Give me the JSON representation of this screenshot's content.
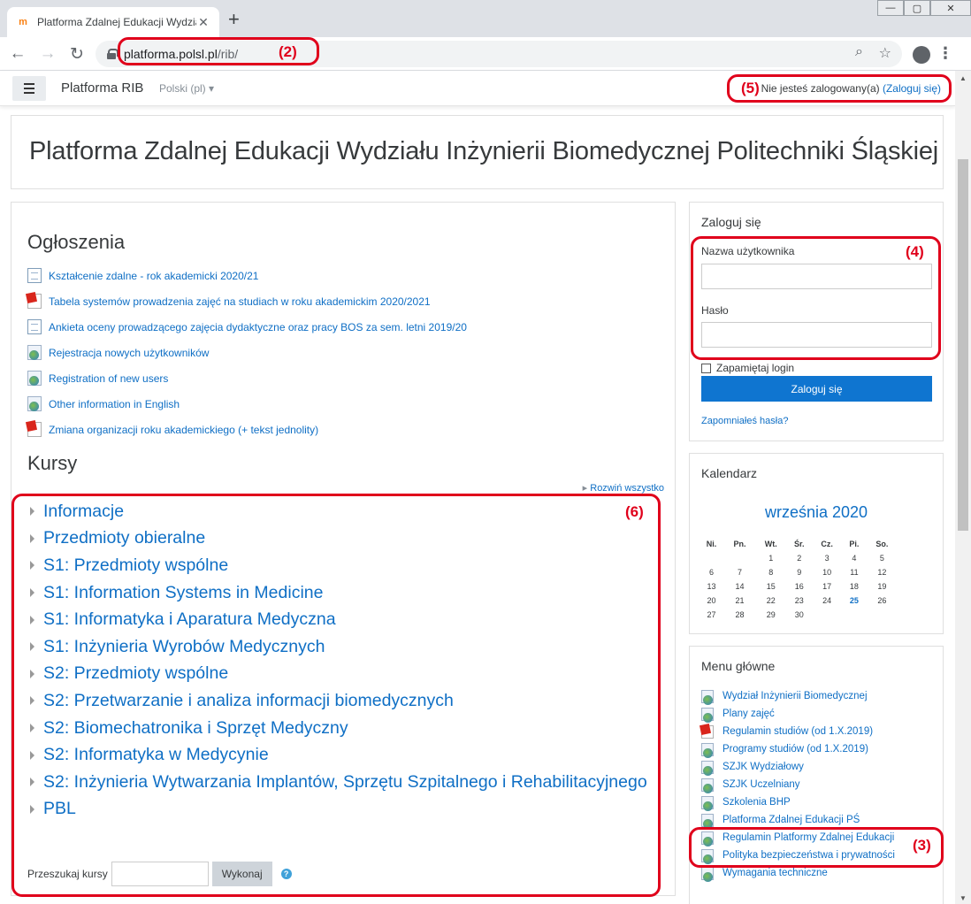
{
  "browser": {
    "tab_title": "Platforma Zdalnej Edukacji Wydział",
    "favicon_text": "m",
    "url_host": "platforma.polsl.pl",
    "url_path": "/rib/"
  },
  "annotations": {
    "url": "(2)",
    "links": "(3)",
    "login": "(4)",
    "status": "(5)",
    "courses": "(6)"
  },
  "navbar": {
    "brand": "Platforma RIB",
    "language": "Polski (pl)",
    "login_status": "Nie jesteś zalogowany(a)",
    "login_link": "(Zaloguj się)"
  },
  "page_title": "Platforma Zdalnej Edukacji Wydziału Inżynierii Biomedycznej Politechniki Śląskiej",
  "announcements": {
    "heading": "Ogłoszenia",
    "items": [
      {
        "label": "Kształcenie zdalne - rok akademicki 2020/21",
        "icon": "page-icon"
      },
      {
        "label": "Tabela systemów prowadzenia zajęć na studiach w roku akademickim 2020/2021",
        "icon": "pdf-icon"
      },
      {
        "label": "Ankieta oceny prowadzącego zajęcia dydaktyczne oraz pracy BOS za sem. letni 2019/20",
        "icon": "page-icon"
      },
      {
        "label": "Rejestracja nowych użytkowników",
        "icon": "url-icon"
      },
      {
        "label": "Registration of new users",
        "icon": "url-icon"
      },
      {
        "label": "Other information in English",
        "icon": "url-icon"
      },
      {
        "label": "Zmiana organizacji roku akademickiego (+ tekst jednolity)",
        "icon": "pdf-icon"
      }
    ]
  },
  "courses": {
    "heading": "Kursy",
    "expand_all": "Rozwiń wszystko",
    "items": [
      "Informacje",
      "Przedmioty obieralne",
      "S1: Przedmioty wspólne",
      "S1: Information Systems in Medicine",
      "S1: Informatyka i Aparatura Medyczna",
      "S1: Inżynieria Wyrobów Medycznych",
      "S2: Przedmioty wspólne",
      "S2: Przetwarzanie i analiza informacji biomedycznych",
      "S2: Biomechatronika i Sprzęt Medyczny",
      "S2: Informatyka w Medycynie",
      "S2: Inżynieria Wytwarzania Implantów, Sprzętu Szpitalnego i Rehabilitacyjnego",
      "PBL"
    ],
    "search_label": "Przeszukaj kursy",
    "search_value": "",
    "search_button": "Wykonaj",
    "help_glyph": "?"
  },
  "login_block": {
    "heading": "Zaloguj się",
    "username_label": "Nazwa użytkownika",
    "username_value": "",
    "password_label": "Hasło",
    "password_value": "",
    "remember_label": "Zapamiętaj login",
    "submit": "Zaloguj się",
    "forgot": "Zapomniałeś hasła?"
  },
  "calendar": {
    "heading": "Kalendarz",
    "month": "września 2020",
    "weekdays": [
      "Ni.",
      "Pn.",
      "Wt.",
      "Śr.",
      "Cz.",
      "Pi.",
      "So."
    ],
    "weeks": [
      [
        "",
        "",
        "1",
        "2",
        "3",
        "4",
        "5"
      ],
      [
        "6",
        "7",
        "8",
        "9",
        "10",
        "11",
        "12"
      ],
      [
        "13",
        "14",
        "15",
        "16",
        "17",
        "18",
        "19"
      ],
      [
        "20",
        "21",
        "22",
        "23",
        "24",
        "25",
        "26"
      ],
      [
        "27",
        "28",
        "29",
        "30",
        "",
        "",
        ""
      ]
    ],
    "today": "25"
  },
  "main_menu": {
    "heading": "Menu główne",
    "items": [
      {
        "label": "Wydział Inżynierii Biomedycznej",
        "icon": "url-icon"
      },
      {
        "label": "Plany zajęć",
        "icon": "url-icon"
      },
      {
        "label": "Regulamin studiów (od 1.X.2019)",
        "icon": "pdf-icon"
      },
      {
        "label": "Programy studiów (od 1.X.2019)",
        "icon": "url-icon"
      },
      {
        "label": "SZJK Wydziałowy",
        "icon": "url-icon"
      },
      {
        "label": "SZJK Uczelniany",
        "icon": "url-icon"
      },
      {
        "label": "Szkolenia BHP",
        "icon": "url-icon"
      },
      {
        "label": "Platforma Zdalnej Edukacji PŚ",
        "icon": "url-icon"
      },
      {
        "label": "Regulamin Platformy Zdalnej Edukacji",
        "icon": "url-icon"
      },
      {
        "label": "Polityka bezpieczeństwa i prywatności",
        "icon": "url-icon"
      },
      {
        "label": "Wymagania techniczne",
        "icon": "url-icon"
      }
    ]
  },
  "colors": {
    "link": "#0f6fc5",
    "annotation": "#e0001b",
    "primary_button": "#0f75d0"
  }
}
